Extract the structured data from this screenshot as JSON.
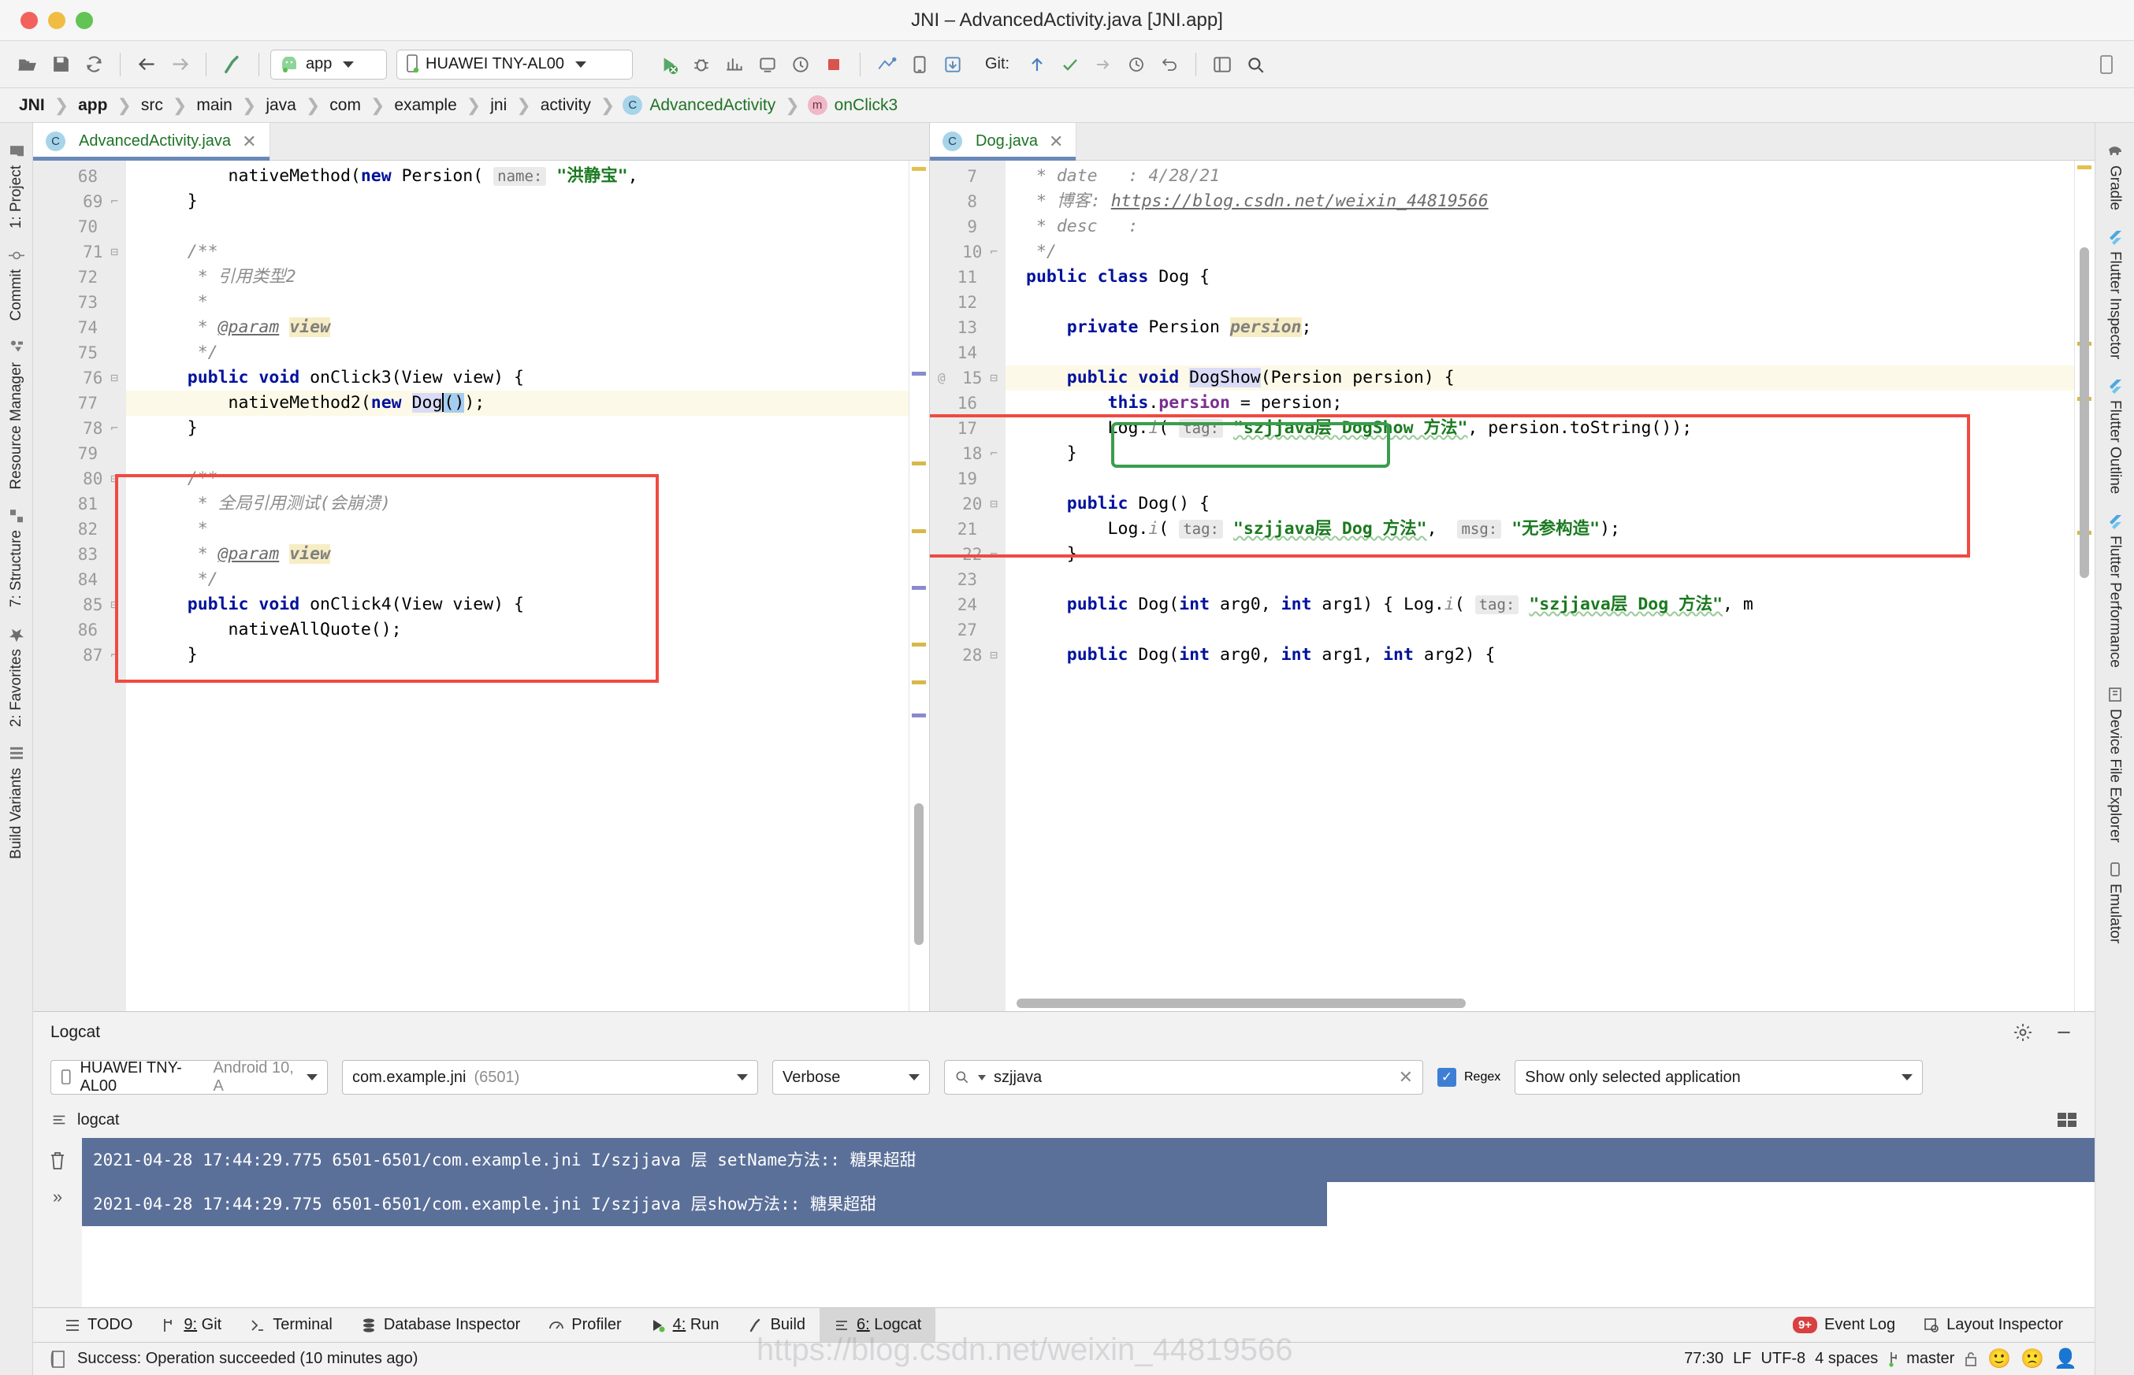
{
  "window": {
    "title": "JNI – AdvancedActivity.java [JNI.app]"
  },
  "toolbar": {
    "icons": [
      "open-folder-icon",
      "save-icon",
      "sync-icon",
      "back-arrow-icon",
      "forward-arrow-icon",
      "build-hammer-icon"
    ],
    "module_selector": "app",
    "device_selector": "HUAWEI TNY-AL00",
    "git_label": "Git:",
    "run_icons": [
      "run-icon",
      "debug-icon",
      "profile-icon",
      "attach-debugger-icon",
      "apply-changes-icon",
      "stop-icon",
      "sdk-manager-icon",
      "avd-manager-icon",
      "device-file-explorer-icon"
    ],
    "git_icons": [
      "update-project-icon",
      "commit-icon",
      "push-icon",
      "history-icon",
      "revert-icon"
    ],
    "right_icons": [
      "project-structure-icon",
      "search-everywhere-icon"
    ]
  },
  "breadcrumb": [
    {
      "label": "JNI",
      "style": "bold"
    },
    {
      "label": "app",
      "style": "bold"
    },
    {
      "label": "src",
      "style": "plain"
    },
    {
      "label": "main",
      "style": "plain"
    },
    {
      "label": "java",
      "style": "plain"
    },
    {
      "label": "com",
      "style": "plain"
    },
    {
      "label": "example",
      "style": "plain"
    },
    {
      "label": "jni",
      "style": "plain"
    },
    {
      "label": "activity",
      "style": "plain"
    },
    {
      "label": "AdvancedActivity",
      "style": "class"
    },
    {
      "label": "onClick3",
      "style": "method"
    }
  ],
  "left_sidebar": [
    {
      "label": "1: Project",
      "icon": "project-folder-icon"
    },
    {
      "label": "Commit",
      "icon": "commit-icon"
    },
    {
      "label": "Resource Manager",
      "icon": "resource-manager-icon"
    },
    {
      "label": "7: Structure",
      "icon": "structure-icon"
    },
    {
      "label": "2: Favorites",
      "icon": "star-icon"
    },
    {
      "label": "Build Variants",
      "icon": "build-variants-icon"
    }
  ],
  "right_sidebar": [
    {
      "label": "Gradle",
      "icon": "gradle-elephant-icon"
    },
    {
      "label": "Flutter Inspector",
      "icon": "flutter-icon"
    },
    {
      "label": "Flutter Outline",
      "icon": "flutter-icon"
    },
    {
      "label": "Flutter Performance",
      "icon": "flutter-icon"
    },
    {
      "label": "Device File Explorer",
      "icon": "device-file-icon"
    },
    {
      "label": "Emulator",
      "icon": "emulator-icon"
    }
  ],
  "editor_left": {
    "tab": {
      "label": "AdvancedActivity.java",
      "icon": "java-class-icon"
    },
    "first_line": 68,
    "lines": [
      {
        "n": 68,
        "fold": "",
        "hl": false,
        "segs": [
          {
            "t": "        nativeMethod(",
            "c": "plain"
          },
          {
            "t": "new",
            "c": "kw"
          },
          {
            "t": " Persion( ",
            "c": "plain"
          },
          {
            "t": "name:",
            "c": "hint"
          },
          {
            "t": " ",
            "c": "plain"
          },
          {
            "t": "\"洪静宝\"",
            "c": "str"
          },
          {
            "t": ",",
            "c": "plain"
          }
        ]
      },
      {
        "n": 69,
        "fold": "end",
        "hl": false,
        "segs": [
          {
            "t": "    }",
            "c": "plain"
          }
        ]
      },
      {
        "n": 70,
        "fold": "",
        "hl": false,
        "segs": [
          {
            "t": "",
            "c": "plain"
          }
        ]
      },
      {
        "n": 71,
        "fold": "start",
        "hl": false,
        "segs": [
          {
            "t": "    /**",
            "c": "cmt"
          }
        ]
      },
      {
        "n": 72,
        "fold": "",
        "hl": false,
        "segs": [
          {
            "t": "     * 引用类型2",
            "c": "cmt"
          }
        ]
      },
      {
        "n": 73,
        "fold": "",
        "hl": false,
        "segs": [
          {
            "t": "     *",
            "c": "cmt"
          }
        ]
      },
      {
        "n": 74,
        "fold": "",
        "hl": false,
        "segs": [
          {
            "t": "     * ",
            "c": "cmt"
          },
          {
            "t": "@param",
            "c": "lnk"
          },
          {
            "t": " ",
            "c": "cmt"
          },
          {
            "t": "view",
            "c": "cmt-hl"
          }
        ]
      },
      {
        "n": 75,
        "fold": "",
        "hl": false,
        "segs": [
          {
            "t": "     */",
            "c": "cmt"
          }
        ]
      },
      {
        "n": 76,
        "fold": "start",
        "hl": false,
        "segs": [
          {
            "t": "    ",
            "c": "plain"
          },
          {
            "t": "public void",
            "c": "kw"
          },
          {
            "t": " onClick3(View view) {",
            "c": "plain"
          }
        ]
      },
      {
        "n": 77,
        "fold": "",
        "hl": true,
        "segs": [
          {
            "t": "        nativeMethod2(",
            "c": "plain"
          },
          {
            "t": "new",
            "c": "kw"
          },
          {
            "t": " ",
            "c": "plain"
          },
          {
            "t": "Dog",
            "c": "sel-lav"
          },
          {
            "t": "caret",
            "c": "caret"
          },
          {
            "t": "()",
            "c": "sel-blue"
          },
          {
            "t": ");",
            "c": "plain"
          }
        ]
      },
      {
        "n": 78,
        "fold": "end",
        "hl": false,
        "segs": [
          {
            "t": "    }",
            "c": "plain"
          }
        ]
      },
      {
        "n": 79,
        "fold": "",
        "hl": false,
        "segs": [
          {
            "t": "",
            "c": "plain"
          }
        ]
      },
      {
        "n": 80,
        "fold": "start",
        "hl": false,
        "segs": [
          {
            "t": "    /**",
            "c": "cmt"
          }
        ]
      },
      {
        "n": 81,
        "fold": "",
        "hl": false,
        "segs": [
          {
            "t": "     * 全局引用测试(会崩溃)",
            "c": "cmt"
          }
        ]
      },
      {
        "n": 82,
        "fold": "",
        "hl": false,
        "segs": [
          {
            "t": "     *",
            "c": "cmt"
          }
        ]
      },
      {
        "n": 83,
        "fold": "",
        "hl": false,
        "segs": [
          {
            "t": "     * ",
            "c": "cmt"
          },
          {
            "t": "@param",
            "c": "lnk"
          },
          {
            "t": " ",
            "c": "cmt"
          },
          {
            "t": "view",
            "c": "cmt-hl"
          }
        ]
      },
      {
        "n": 84,
        "fold": "",
        "hl": false,
        "segs": [
          {
            "t": "     */",
            "c": "cmt"
          }
        ]
      },
      {
        "n": 85,
        "fold": "start",
        "hl": false,
        "segs": [
          {
            "t": "    ",
            "c": "plain"
          },
          {
            "t": "public void",
            "c": "kw"
          },
          {
            "t": " onClick4(View view) {",
            "c": "plain"
          }
        ]
      },
      {
        "n": 86,
        "fold": "",
        "hl": false,
        "segs": [
          {
            "t": "        nativeAllQuote();",
            "c": "plain"
          }
        ]
      },
      {
        "n": 87,
        "fold": "end",
        "hl": false,
        "segs": [
          {
            "t": "    }",
            "c": "plain"
          }
        ]
      }
    ]
  },
  "editor_right": {
    "tab": {
      "label": "Dog.java",
      "icon": "java-class-icon"
    },
    "lines": [
      {
        "n": 7,
        "fold": "",
        "hl": false,
        "segs": [
          {
            "t": " * ",
            "c": "cmt"
          },
          {
            "t": "date",
            "c": "cmt"
          },
          {
            "t": "   : 4/28/21",
            "c": "cmt"
          }
        ]
      },
      {
        "n": 8,
        "fold": "",
        "hl": false,
        "segs": [
          {
            "t": " * 博客: ",
            "c": "cmt"
          },
          {
            "t": "https://blog.csdn.net/weixin_44819566",
            "c": "lnk"
          }
        ]
      },
      {
        "n": 9,
        "fold": "",
        "hl": false,
        "segs": [
          {
            "t": " * desc   :",
            "c": "cmt"
          }
        ]
      },
      {
        "n": 10,
        "fold": "end",
        "hl": false,
        "segs": [
          {
            "t": " */",
            "c": "cmt"
          }
        ]
      },
      {
        "n": 11,
        "fold": "",
        "hl": false,
        "segs": [
          {
            "t": "public class",
            "c": "kw"
          },
          {
            "t": " Dog {",
            "c": "plain"
          }
        ]
      },
      {
        "n": 12,
        "fold": "",
        "hl": false,
        "segs": [
          {
            "t": "",
            "c": "plain"
          }
        ]
      },
      {
        "n": 13,
        "fold": "",
        "hl": false,
        "segs": [
          {
            "t": "    ",
            "c": "plain"
          },
          {
            "t": "private",
            "c": "kw"
          },
          {
            "t": " Persion ",
            "c": "plain"
          },
          {
            "t": "persion",
            "c": "cmt-hl"
          },
          {
            "t": ";",
            "c": "plain"
          }
        ]
      },
      {
        "n": 14,
        "fold": "",
        "hl": false,
        "segs": [
          {
            "t": "",
            "c": "plain"
          }
        ]
      },
      {
        "n": 15,
        "fold": "start",
        "hl": true,
        "gmark": "@",
        "segs": [
          {
            "t": "    ",
            "c": "plain"
          },
          {
            "t": "public void",
            "c": "kw"
          },
          {
            "t": " ",
            "c": "plain"
          },
          {
            "t": "DogShow",
            "c": "sel-lav"
          },
          {
            "t": "(Persion persion) {",
            "c": "plain"
          }
        ]
      },
      {
        "n": 16,
        "fold": "",
        "hl": false,
        "segs": [
          {
            "t": "        ",
            "c": "plain"
          },
          {
            "t": "this",
            "c": "kw"
          },
          {
            "t": ".",
            "c": "plain"
          },
          {
            "t": "persion",
            "c": "field"
          },
          {
            "t": " = persion;",
            "c": "plain"
          }
        ]
      },
      {
        "n": 17,
        "fold": "",
        "hl": false,
        "segs": [
          {
            "t": "        Log.",
            "c": "plain"
          },
          {
            "t": "i",
            "c": "italic"
          },
          {
            "t": "( ",
            "c": "plain"
          },
          {
            "t": "tag:",
            "c": "hint"
          },
          {
            "t": " ",
            "c": "plain"
          },
          {
            "t": "\"szjjava层 DogShow 方法\"",
            "c": "str-wavy"
          },
          {
            "t": ", persion.toString());",
            "c": "plain"
          }
        ]
      },
      {
        "n": 18,
        "fold": "end",
        "hl": false,
        "segs": [
          {
            "t": "    }",
            "c": "plain"
          }
        ]
      },
      {
        "n": 19,
        "fold": "",
        "hl": false,
        "segs": [
          {
            "t": "",
            "c": "plain"
          }
        ]
      },
      {
        "n": 20,
        "fold": "start",
        "hl": false,
        "segs": [
          {
            "t": "    ",
            "c": "plain"
          },
          {
            "t": "public",
            "c": "kw"
          },
          {
            "t": " Dog() {",
            "c": "plain"
          }
        ]
      },
      {
        "n": 21,
        "fold": "",
        "hl": false,
        "segs": [
          {
            "t": "        Log.",
            "c": "plain"
          },
          {
            "t": "i",
            "c": "italic"
          },
          {
            "t": "( ",
            "c": "plain"
          },
          {
            "t": "tag:",
            "c": "hint"
          },
          {
            "t": " ",
            "c": "plain"
          },
          {
            "t": "\"szjjava层 Dog 方法\"",
            "c": "str-wavy"
          },
          {
            "t": ",  ",
            "c": "plain"
          },
          {
            "t": "msg:",
            "c": "hint"
          },
          {
            "t": " ",
            "c": "plain"
          },
          {
            "t": "\"无参构造\"",
            "c": "str"
          },
          {
            "t": ");",
            "c": "plain"
          }
        ]
      },
      {
        "n": 22,
        "fold": "end",
        "hl": false,
        "segs": [
          {
            "t": "    }",
            "c": "plain"
          }
        ]
      },
      {
        "n": 23,
        "fold": "",
        "hl": false,
        "segs": [
          {
            "t": "",
            "c": "plain"
          }
        ]
      },
      {
        "n": 24,
        "fold": "",
        "hl": false,
        "segs": [
          {
            "t": "    ",
            "c": "plain"
          },
          {
            "t": "public",
            "c": "kw"
          },
          {
            "t": " Dog(",
            "c": "plain"
          },
          {
            "t": "int",
            "c": "kw"
          },
          {
            "t": " arg0, ",
            "c": "plain"
          },
          {
            "t": "int",
            "c": "kw"
          },
          {
            "t": " arg1) { Log.",
            "c": "plain"
          },
          {
            "t": "i",
            "c": "italic"
          },
          {
            "t": "( ",
            "c": "plain"
          },
          {
            "t": "tag:",
            "c": "hint"
          },
          {
            "t": " ",
            "c": "plain"
          },
          {
            "t": "\"szjjava层 Dog 方法\"",
            "c": "str-wavy"
          },
          {
            "t": ", m",
            "c": "plain"
          }
        ]
      },
      {
        "n": 27,
        "fold": "",
        "hl": false,
        "segs": [
          {
            "t": "",
            "c": "plain"
          }
        ]
      },
      {
        "n": 28,
        "fold": "start",
        "hl": false,
        "segs": [
          {
            "t": "    ",
            "c": "plain"
          },
          {
            "t": "public",
            "c": "kw"
          },
          {
            "t": " Dog(",
            "c": "plain"
          },
          {
            "t": "int",
            "c": "kw"
          },
          {
            "t": " arg0, ",
            "c": "plain"
          },
          {
            "t": "int",
            "c": "kw"
          },
          {
            "t": " arg1, ",
            "c": "plain"
          },
          {
            "t": "int",
            "c": "kw"
          },
          {
            "t": " arg2) {",
            "c": "plain"
          }
        ]
      }
    ]
  },
  "annotations": {
    "red_box_left": "highlight-onclick3-method",
    "red_box_right": "highlight-dogshow-block",
    "green_box_right": "highlight-dogshow-signature"
  },
  "logcat": {
    "title": "Logcat",
    "header_icons": [
      "settings-gear-icon",
      "minimize-icon"
    ],
    "device": {
      "name": "HUAWEI TNY-AL00",
      "detail": "Android 10, A"
    },
    "process": {
      "name": "com.example.jni",
      "pid": "(6501)"
    },
    "level": "Verbose",
    "search": {
      "value": "szjjava",
      "placeholder": ""
    },
    "regex_label": "Regex",
    "regex_checked": true,
    "filter": "Show only selected application",
    "tab_label": "logcat",
    "lines": [
      "2021-04-28 17:44:29.775 6501-6501/com.example.jni I/szjjava 层 setName方法:: 糖果超甜",
      "2021-04-28 17:44:29.775 6501-6501/com.example.jni I/szjjava 层show方法:: 糖果超甜"
    ],
    "gutter_icons": [
      "trash-icon",
      "expand-icon"
    ],
    "right_icon": "wrap-lines-icon"
  },
  "toolwindows": [
    {
      "label": "TODO",
      "icon": "todo-icon",
      "active": false,
      "num": ""
    },
    {
      "label": "Git",
      "icon": "git-icon",
      "active": false,
      "num": "9:"
    },
    {
      "label": "Terminal",
      "icon": "terminal-icon",
      "active": false,
      "num": ""
    },
    {
      "label": "Database Inspector",
      "icon": "database-icon",
      "active": false,
      "num": ""
    },
    {
      "label": "Profiler",
      "icon": "profiler-icon",
      "active": false,
      "num": ""
    },
    {
      "label": "Run",
      "icon": "run-icon",
      "active": false,
      "num": "4:"
    },
    {
      "label": "Build",
      "icon": "build-icon",
      "active": false,
      "num": ""
    },
    {
      "label": "Logcat",
      "icon": "logcat-icon",
      "active": true,
      "num": "6:"
    }
  ],
  "toolwindows_right": [
    {
      "label": "Event Log",
      "icon": "event-log-icon",
      "badge": "9+"
    },
    {
      "label": "Layout Inspector",
      "icon": "layout-inspector-icon",
      "badge": ""
    }
  ],
  "statusbar": {
    "message": "Success: Operation succeeded (10 minutes ago)",
    "icon": "build-status-icon",
    "position": "77:30",
    "line_sep": "LF",
    "encoding": "UTF-8",
    "indent": "4 spaces",
    "branch": "master",
    "right_icons": [
      "lock-icon",
      "happy-face-icon",
      "sad-face-icon",
      "inspection-icon"
    ]
  },
  "watermark": "https://blog.csdn.net/weixin_44819566",
  "colors": {
    "accent": "#6989b8",
    "keyword": "#00119c",
    "string": "#1a7a1f",
    "comment": "#8c8c8c",
    "annotation_red": "#f04a42",
    "annotation_green": "#3a9d4e",
    "logcat_selection": "#5b7099"
  }
}
